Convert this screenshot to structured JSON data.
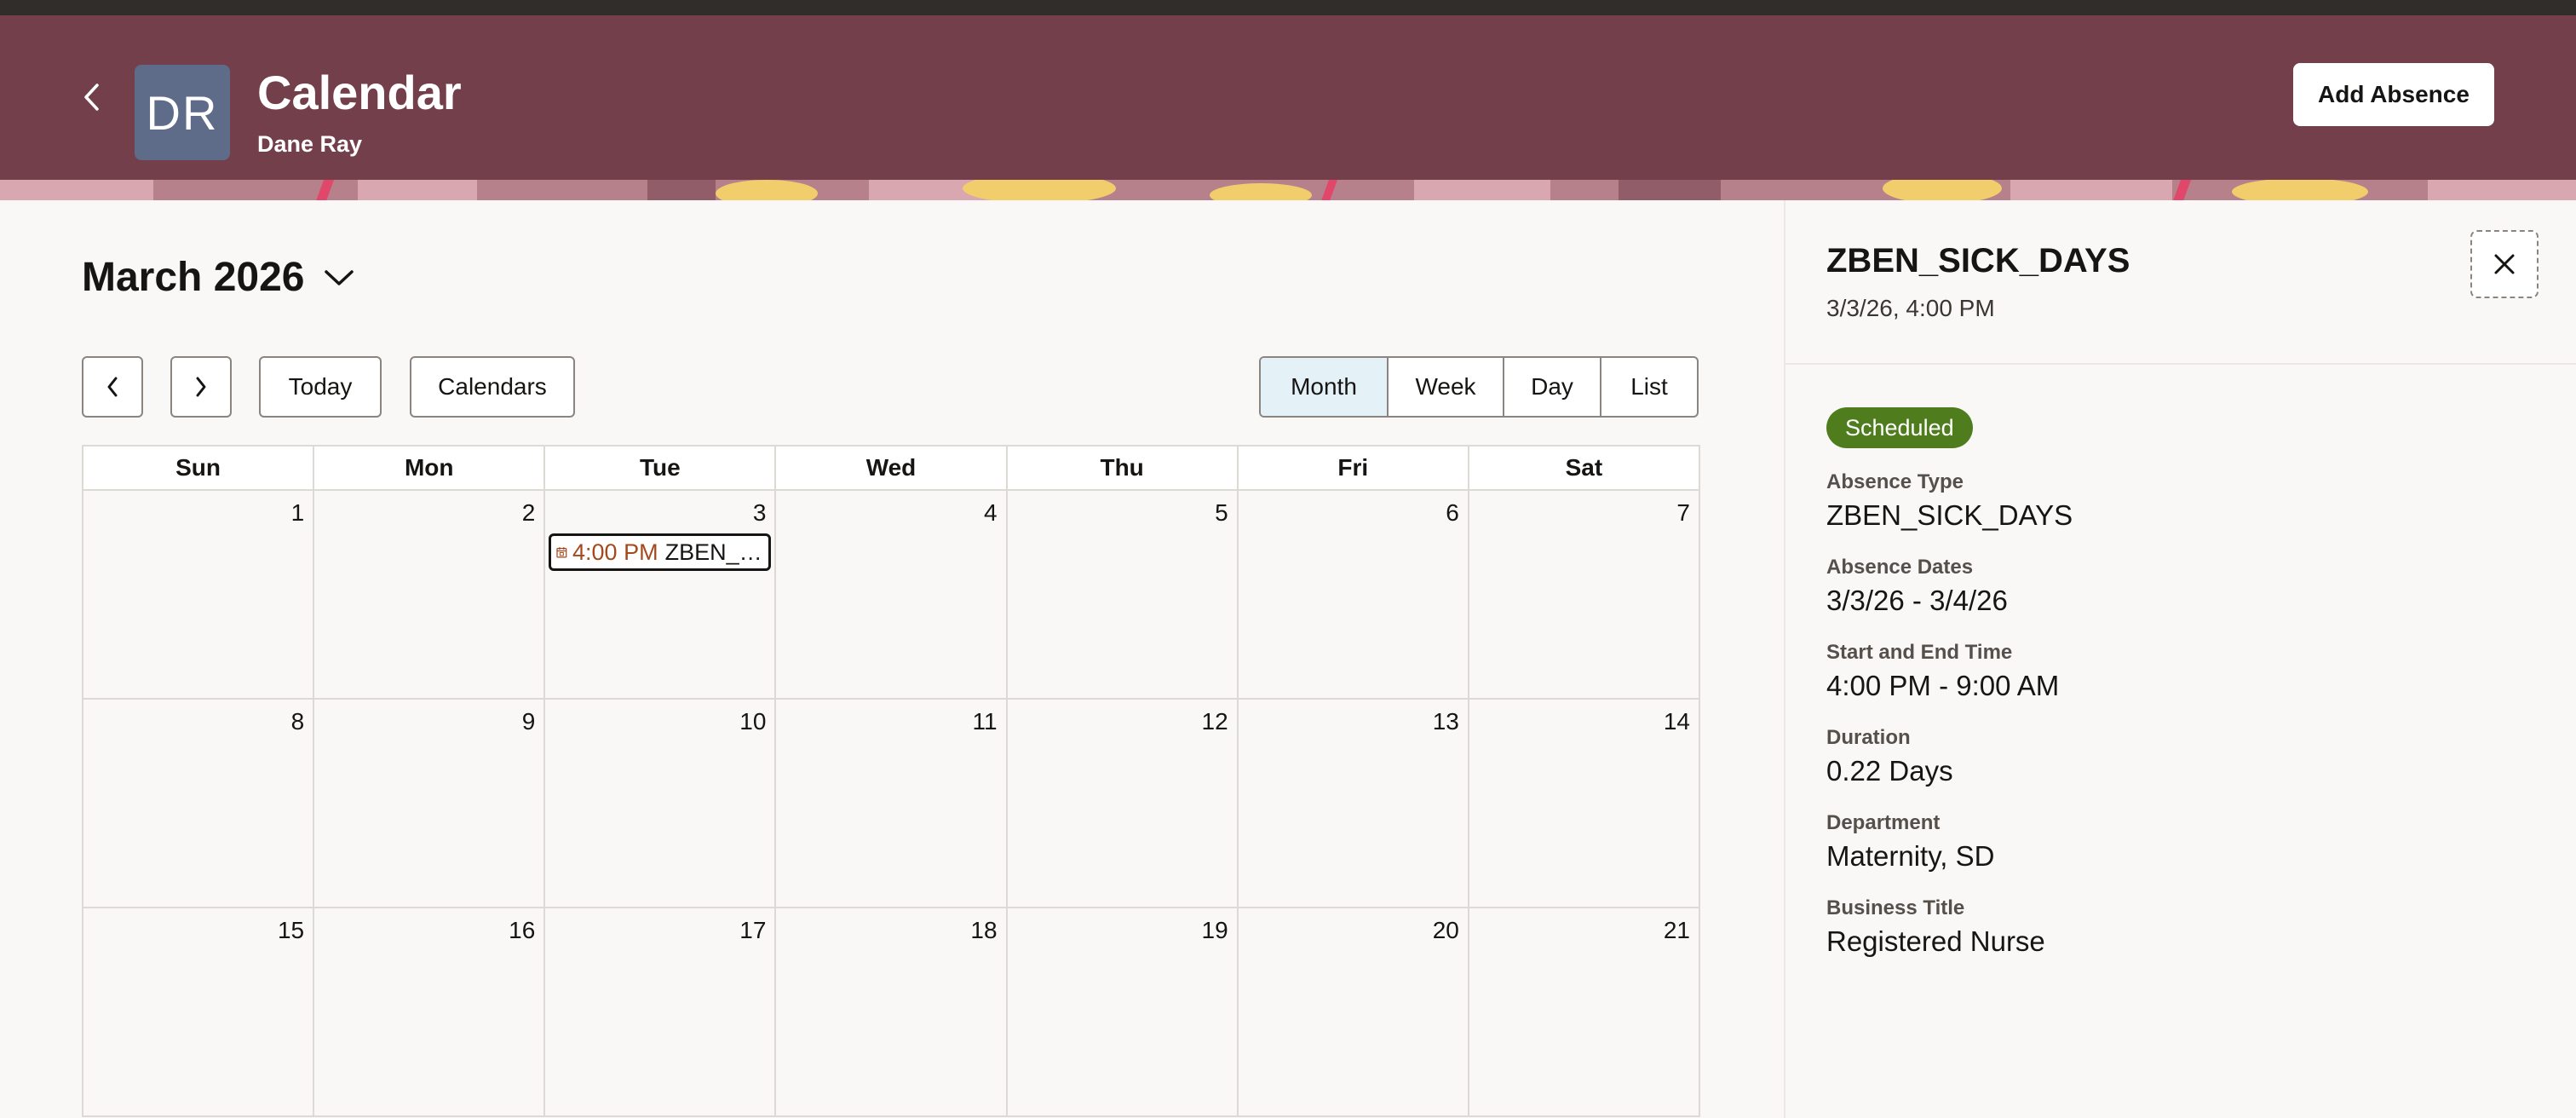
{
  "header": {
    "title": "Calendar",
    "subtitle": "Dane Ray",
    "avatar_initials": "DR",
    "add_absence_label": "Add Absence"
  },
  "calendar": {
    "month_label": "March 2026",
    "buttons": {
      "prev": "‹",
      "next": "›",
      "today": "Today",
      "calendars": "Calendars"
    },
    "views": {
      "month": "Month",
      "week": "Week",
      "day": "Day",
      "list": "List",
      "active": "Month"
    },
    "weekdays": [
      "Sun",
      "Mon",
      "Tue",
      "Wed",
      "Thu",
      "Fri",
      "Sat"
    ],
    "weeks": [
      [
        "1",
        "2",
        "3",
        "4",
        "5",
        "6",
        "7"
      ],
      [
        "8",
        "9",
        "10",
        "11",
        "12",
        "13",
        "14"
      ],
      [
        "15",
        "16",
        "17",
        "18",
        "19",
        "20",
        "21"
      ]
    ],
    "event": {
      "day": "3",
      "time": "4:00 PM",
      "title": "ZBEN_SICK_DAYS"
    }
  },
  "detail": {
    "title": "ZBEN_SICK_DAYS",
    "subtitle": "3/3/26, 4:00 PM",
    "status": "Scheduled",
    "fields": {
      "absence_type": {
        "label": "Absence Type",
        "value": "ZBEN_SICK_DAYS"
      },
      "absence_dates": {
        "label": "Absence Dates",
        "value": "3/3/26 - 3/4/26"
      },
      "start_end": {
        "label": "Start and End Time",
        "value": "4:00 PM - 9:00 AM"
      },
      "duration": {
        "label": "Duration",
        "value": "0.22 Days"
      },
      "department": {
        "label": "Department",
        "value": "Maternity, SD"
      },
      "business_title": {
        "label": "Business Title",
        "value": "Registered Nurse"
      }
    }
  },
  "colors": {
    "header_bg": "#733f4b",
    "status_green": "#4f7d1e",
    "event_time": "#a4491b",
    "active_view_bg": "#e4f1f7"
  }
}
